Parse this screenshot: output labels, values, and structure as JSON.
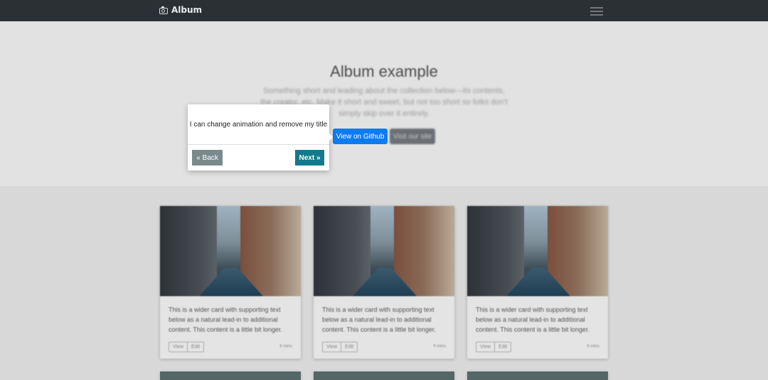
{
  "navbar": {
    "brand": "Album",
    "brand_icon": "camera-icon",
    "toggler_icon": "hamburger-icon"
  },
  "hero": {
    "title": "Album example",
    "lead": "Something short and leading about the collection below—its contents, the creator, etc. Make it short and sweet, but not too short so folks don't simply skip over it entirely.",
    "primary_button": "View on Github",
    "secondary_button": "Visit our site"
  },
  "cards": [
    {
      "text": "This is a wider card with supporting text below as a natural lead-in to additional content. This content is a little bit longer.",
      "view": "View",
      "edit": "Edit",
      "time": "9 mins"
    },
    {
      "text": "This is a wider card with supporting text below as a natural lead-in to additional content. This content is a little bit longer.",
      "view": "View",
      "edit": "Edit",
      "time": "9 mins"
    },
    {
      "text": "This is a wider card with supporting text below as a natural lead-in to additional content. This content is a little bit longer.",
      "view": "View",
      "edit": "Edit",
      "time": "9 mins"
    }
  ],
  "popover": {
    "body": "I can change animation and remove my title",
    "back_label": "« Back",
    "next_label": "Next »"
  },
  "colors": {
    "primary": "#0d7bf2",
    "next": "#137a8d",
    "back": "#7a8a8c",
    "navbar": "#2b3035"
  }
}
